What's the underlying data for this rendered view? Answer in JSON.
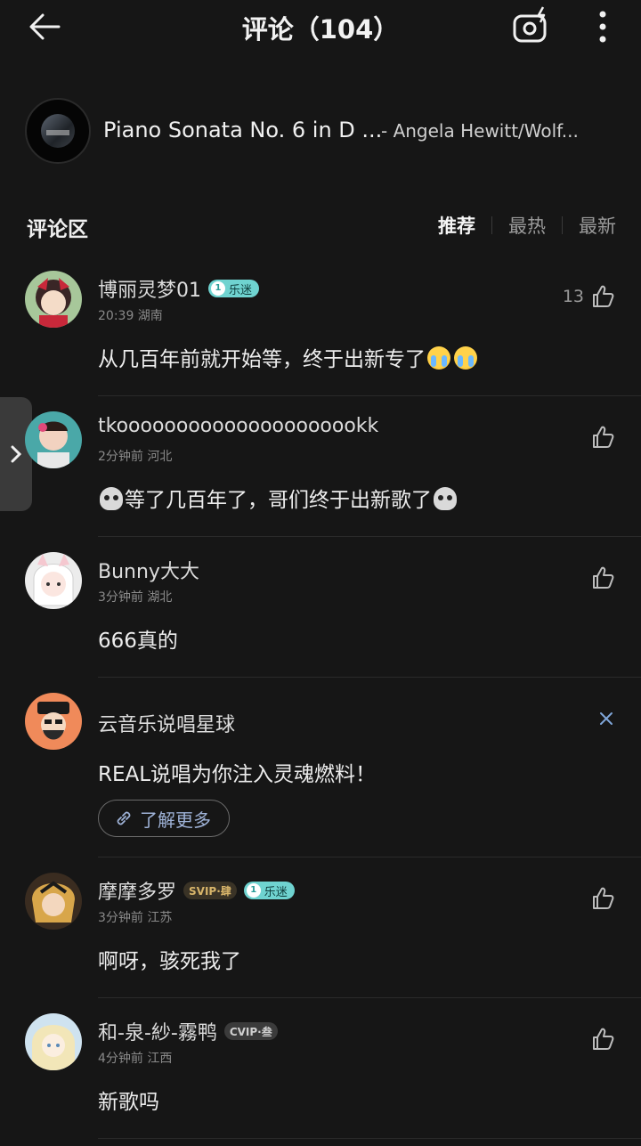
{
  "header": {
    "title": "评论（104）"
  },
  "song": {
    "title": "Piano Sonata No. 6 in D ...",
    "artist": "- Angela Hewitt/Wolf..."
  },
  "section": {
    "title": "评论区",
    "tabs": [
      {
        "label": "推荐",
        "active": true
      },
      {
        "label": "最热",
        "active": false
      },
      {
        "label": "最新",
        "active": false
      }
    ]
  },
  "comments": [
    {
      "user": "博丽灵梦01",
      "badge": "乐迷",
      "meta": "20:39 湖南",
      "text": "从几百年前就开始等，终于出新专了",
      "emoji": "crying-face",
      "likes": "13"
    },
    {
      "user": "tkooooooooooooooooooookk",
      "meta": "2分钟前 河北",
      "text": "等了几百年了，哥们终于出新歌了",
      "emoji": "skull",
      "likes": ""
    },
    {
      "user": "Bunny大大",
      "meta": "3分钟前 湖北",
      "text": "666真的",
      "likes": ""
    },
    {
      "user": "摩摩多罗",
      "vip_badge": "SVIP·肆",
      "badge": "乐迷",
      "meta": "3分钟前 江苏",
      "text": "啊呀，骇死我了",
      "likes": ""
    },
    {
      "user": "和-泉-紗-霧鸭",
      "vip_badge": "CVIP·叁",
      "meta": "4分钟前 江西",
      "text": "新歌吗",
      "likes": ""
    }
  ],
  "ad": {
    "name": "云音乐说唱星球",
    "text": "REAL说唱为你注入灵魂燃料！",
    "link_label": "了解更多"
  },
  "colors": {
    "background": "#161616",
    "badge_lemi": "#6fd3d0",
    "link": "#9fb3d8"
  }
}
